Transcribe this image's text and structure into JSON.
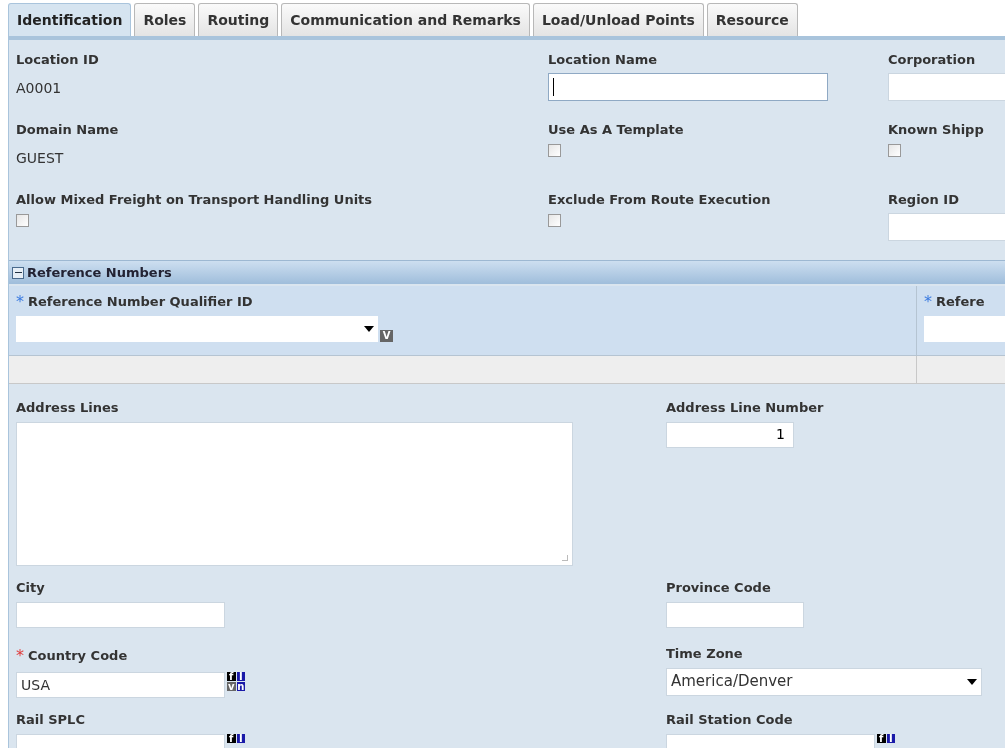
{
  "tabs": [
    {
      "label": "Identification",
      "selected": true
    },
    {
      "label": "Roles",
      "selected": false
    },
    {
      "label": "Routing",
      "selected": false
    },
    {
      "label": "Communication and Remarks",
      "selected": false
    },
    {
      "label": "Load/Unload Points",
      "selected": false
    },
    {
      "label": "Resource",
      "selected": false
    }
  ],
  "general_fields": [
    {
      "label": "Location ID",
      "kind": "text",
      "value": "A0001"
    },
    {
      "label": "Location Name",
      "kind": "input",
      "focused": true
    },
    {
      "label": "Corporation",
      "kind": "input",
      "focused": false
    },
    {
      "label": "Domain Name",
      "kind": "text",
      "value": "GUEST"
    },
    {
      "label": "Use As A Template",
      "kind": "checkbox",
      "checked": false
    },
    {
      "label": "Known Shipp",
      "kind": "checkbox",
      "checked": false
    },
    {
      "label": "Allow Mixed Freight on Transport Handling Units",
      "kind": "checkbox",
      "checked": false
    },
    {
      "label": "Exclude From Route Execution",
      "kind": "checkbox",
      "checked": false
    },
    {
      "label": "Region ID",
      "kind": "input",
      "focused": false
    }
  ],
  "reference_numbers": {
    "title": "Reference Numbers",
    "expanded": true,
    "columns": [
      {
        "label": "Reference Number Qualifier ID",
        "required_mark": "*",
        "kind": "select",
        "badge": "V"
      },
      {
        "label": "Refere",
        "required_mark": "*",
        "kind": "input"
      }
    ]
  },
  "address_fields": [
    {
      "label": "Address Lines",
      "kind": "textarea"
    },
    {
      "label": "Address Line Number",
      "kind": "number",
      "value": "1"
    },
    {
      "label": "City",
      "kind": "input"
    },
    {
      "label": "Province Code",
      "kind": "short"
    },
    {
      "label": "Country Code",
      "kind": "lookup",
      "required_mark": "*",
      "value": "USA",
      "badges": [
        "f",
        "I",
        "v",
        "n"
      ]
    },
    {
      "label": "Time Zone",
      "kind": "select",
      "value": "America/Denver"
    },
    {
      "label": "Rail SPLC",
      "kind": "lookup",
      "badges": [
        "f",
        "I"
      ]
    },
    {
      "label": "Rail Station Code",
      "kind": "lookup",
      "badges": [
        "f",
        "I"
      ]
    }
  ]
}
